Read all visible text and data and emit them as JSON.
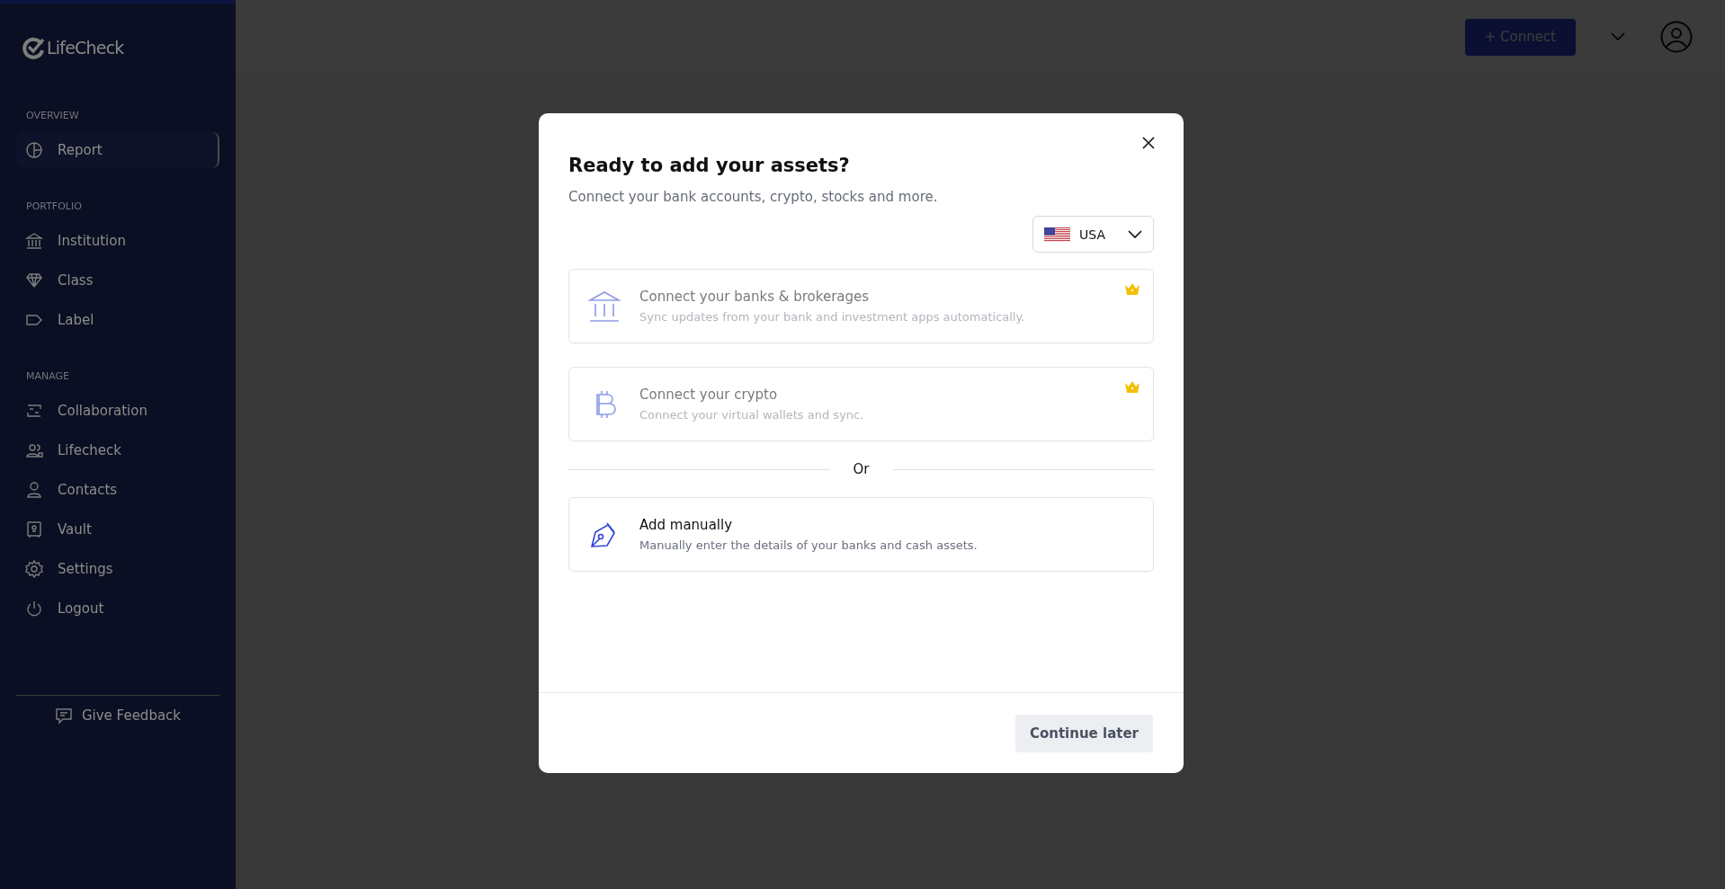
{
  "sidebar": {
    "logo": "LifeCheck",
    "sections": [
      {
        "heading": "OVERVIEW",
        "items": [
          {
            "label": "Report",
            "selected": true
          }
        ]
      },
      {
        "heading": "PORTFOLIO",
        "items": [
          {
            "label": "Institution",
            "selected": false
          },
          {
            "label": "Class",
            "selected": false
          },
          {
            "label": "Label",
            "selected": false
          }
        ]
      },
      {
        "heading": "MANAGE",
        "items": [
          {
            "label": "Collaboration",
            "selected": false
          },
          {
            "label": "Lifecheck",
            "selected": false
          },
          {
            "label": "Contacts",
            "selected": false
          },
          {
            "label": "Vault",
            "selected": false
          },
          {
            "label": "Settings",
            "selected": false
          },
          {
            "label": "Logout",
            "selected": false
          }
        ]
      }
    ],
    "feedback": "Give Feedback"
  },
  "header": {
    "connect_button": "+ Connect"
  },
  "dialog": {
    "title": "Ready to add your assets?",
    "subtitle": "Connect your bank accounts, crypto, stocks and more.",
    "country": "USA",
    "options": [
      {
        "kind": "bank",
        "title": "Connect your banks & brokerages",
        "description": "Sync updates from your bank and investment apps automatically.",
        "disabled": true,
        "premium": true
      },
      {
        "kind": "crypto",
        "title": "Connect your crypto",
        "description": "Connect your virtual wallets and sync.",
        "disabled": true,
        "premium": true
      },
      {
        "kind": "divider",
        "title": "Or"
      },
      {
        "kind": "manual",
        "title": "Add manually",
        "description": "Manually enter the details of your banks and cash assets.",
        "disabled": false,
        "premium": false
      }
    ],
    "footer_button": "Continue later"
  }
}
